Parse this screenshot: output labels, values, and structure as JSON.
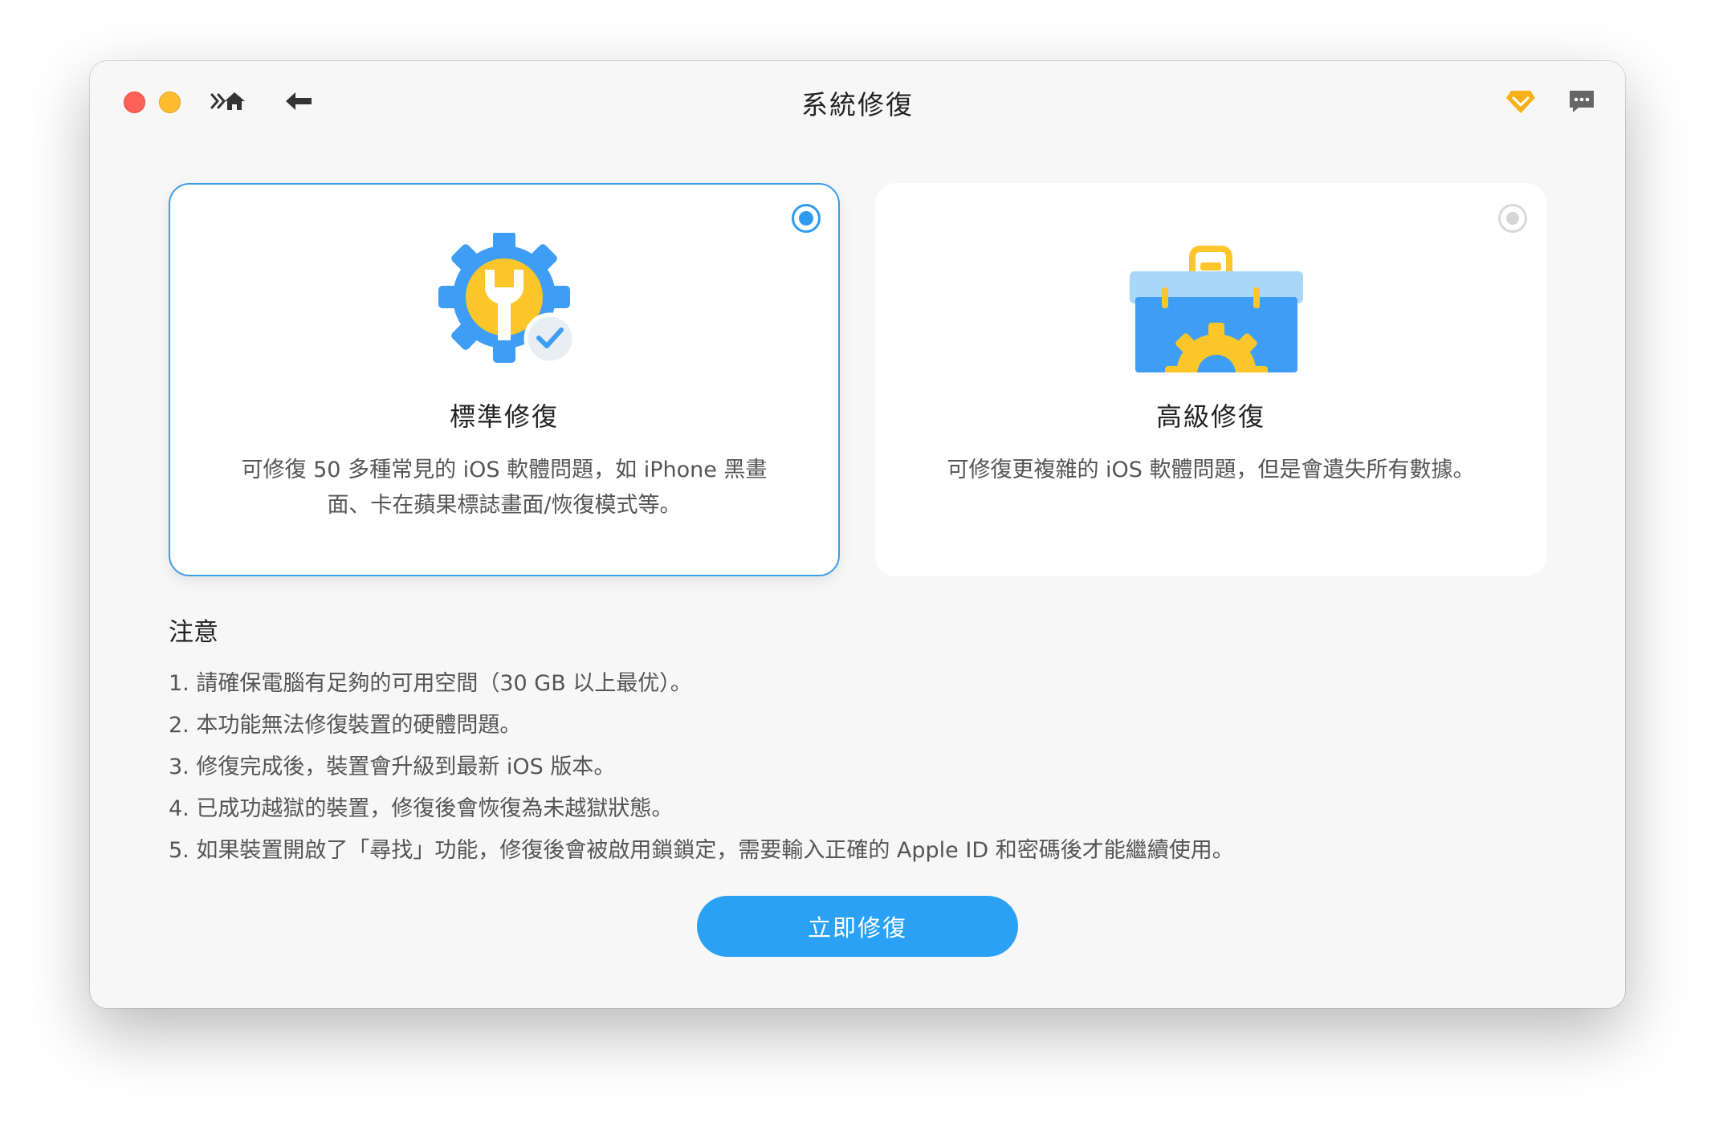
{
  "window": {
    "title": "系統修復"
  },
  "toolbar": {
    "home_icon": "home-icon",
    "back_icon": "back-arrow-icon",
    "vip_icon": "diamond-icon",
    "feedback_icon": "chat-icon"
  },
  "modes": [
    {
      "title": "標準修復",
      "description": "可修復 50 多種常見的 iOS 軟體問題，如 iPhone 黑畫面、卡在蘋果標誌畫面/恢復模式等。",
      "selected": true,
      "icon": "gear-wrench-check-icon"
    },
    {
      "title": "高級修復",
      "description": "可修復更複雜的 iOS 軟體問題，但是會遺失所有數據。",
      "selected": false,
      "icon": "toolbox-gear-icon"
    }
  ],
  "notes": {
    "heading": "注意",
    "items": [
      "1. 請確保電腦有足夠的可用空間（30 GB 以上最优）。",
      "2. 本功能無法修復裝置的硬體問題。",
      "3. 修復完成後，裝置會升級到最新 iOS 版本。",
      "4. 已成功越獄的裝置，修復後會恢復為未越獄狀態。",
      "5. 如果裝置開啟了「尋找」功能，修復後會被啟用鎖鎖定，需要輸入正確的 Apple ID 和密碼後才能繼續使用。"
    ]
  },
  "action": {
    "repair_label": "立即修復"
  },
  "colors": {
    "accent": "#2aa1f5",
    "selected_border": "#3a9ee6",
    "window_bg": "#f7f7f7"
  }
}
